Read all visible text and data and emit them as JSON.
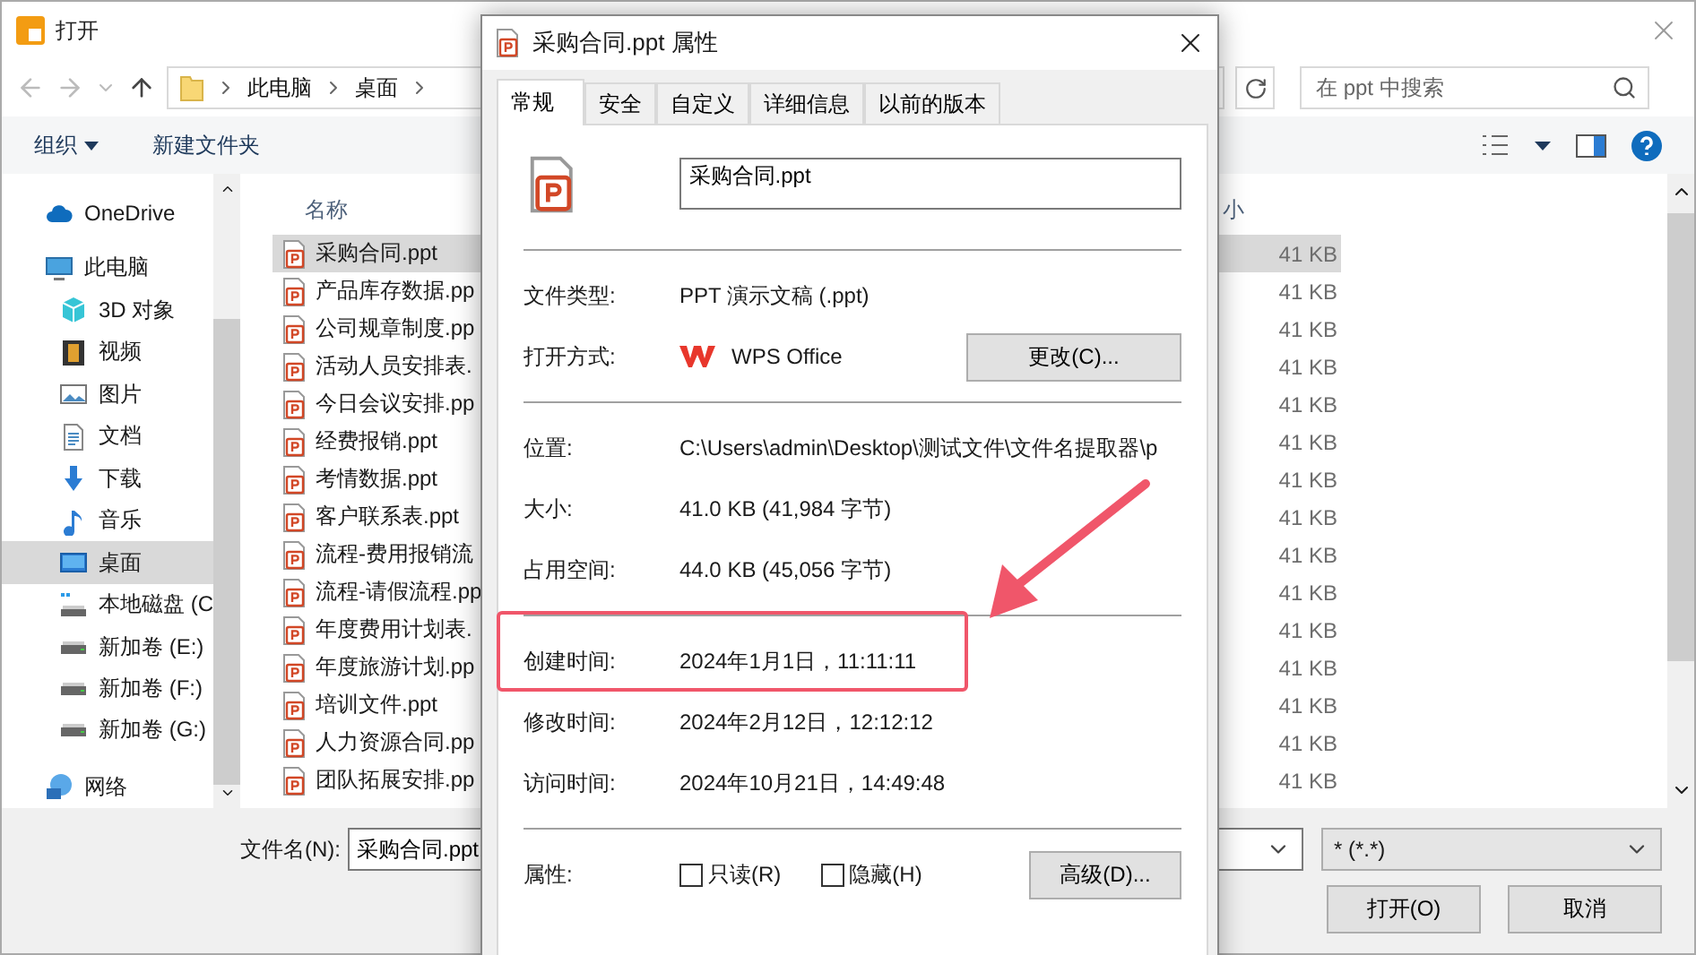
{
  "open_dialog": {
    "title": "打开",
    "breadcrumb": [
      "此电脑",
      "桌面"
    ],
    "search_placeholder": "在 ppt 中搜索",
    "toolbar": {
      "organize": "组织",
      "new_folder": "新建文件夹"
    },
    "sidebar": {
      "items": [
        {
          "kind": "cloud",
          "label": "OneDrive",
          "selected": false
        },
        {
          "kind": "pc",
          "label": "此电脑",
          "selected": false,
          "children": [
            {
              "kind": "cube",
              "label": "3D 对象",
              "selected": false
            },
            {
              "kind": "video",
              "label": "视频",
              "selected": false
            },
            {
              "kind": "image",
              "label": "图片",
              "selected": false
            },
            {
              "kind": "doc",
              "label": "文档",
              "selected": false
            },
            {
              "kind": "download",
              "label": "下载",
              "selected": false
            },
            {
              "kind": "music",
              "label": "音乐",
              "selected": false
            },
            {
              "kind": "desktop",
              "label": "桌面",
              "selected": true
            },
            {
              "kind": "system_drive",
              "label": "本地磁盘 (C",
              "selected": false
            },
            {
              "kind": "drive",
              "label": "新加卷 (E:)",
              "selected": false
            },
            {
              "kind": "drive",
              "label": "新加卷 (F:)",
              "selected": false
            },
            {
              "kind": "drive",
              "label": "新加卷 (G:)",
              "selected": false
            }
          ]
        },
        {
          "kind": "network",
          "label": "网络",
          "selected": false
        }
      ]
    },
    "columns": {
      "name": "名称",
      "size": "小"
    },
    "files": [
      {
        "name": "采购合同.ppt",
        "size": "41 KB",
        "selected": true
      },
      {
        "name": "产品库存数据.pp",
        "size": "41 KB",
        "selected": false
      },
      {
        "name": "公司规章制度.pp",
        "size": "41 KB",
        "selected": false
      },
      {
        "name": "活动人员安排表.",
        "size": "41 KB",
        "selected": false
      },
      {
        "name": "今日会议安排.pp",
        "size": "41 KB",
        "selected": false
      },
      {
        "name": "经费报销.ppt",
        "size": "41 KB",
        "selected": false
      },
      {
        "name": "考情数据.ppt",
        "size": "41 KB",
        "selected": false
      },
      {
        "name": "客户联系表.ppt",
        "size": "41 KB",
        "selected": false
      },
      {
        "name": "流程-费用报销流",
        "size": "41 KB",
        "selected": false
      },
      {
        "name": "流程-请假流程.pp",
        "size": "41 KB",
        "selected": false
      },
      {
        "name": "年度费用计划表.",
        "size": "41 KB",
        "selected": false
      },
      {
        "name": "年度旅游计划.pp",
        "size": "41 KB",
        "selected": false
      },
      {
        "name": "培训文件.ppt",
        "size": "41 KB",
        "selected": false
      },
      {
        "name": "人力资源合同.pp",
        "size": "41 KB",
        "selected": false
      },
      {
        "name": "团队拓展安排.pp",
        "size": "41 KB",
        "selected": false
      }
    ],
    "file_name_label": "文件名(N):",
    "file_name_value": "采购合同.ppt",
    "file_type_filter": "* (*.*)",
    "buttons": [
      "打开(O)",
      "取消"
    ]
  },
  "properties_dialog": {
    "title": "采购合同.ppt 属性",
    "tabs": [
      {
        "label": "常规",
        "selected": true
      },
      {
        "label": "安全",
        "selected": false
      },
      {
        "label": "自定义",
        "selected": false
      },
      {
        "label": "详细信息",
        "selected": false
      },
      {
        "label": "以前的版本",
        "selected": false
      }
    ],
    "file_name": "采购合同.ppt",
    "sections": [
      {
        "rows": [
          {
            "kind": "value",
            "label": "文件类型:",
            "value": "PPT 演示文稿 (.ppt)",
            "highlighted": false
          },
          {
            "kind": "open_with",
            "label": "打开方式:",
            "value": "WPS Office",
            "button": "更改(C)...",
            "highlighted": false
          }
        ]
      },
      {
        "rows": [
          {
            "kind": "value",
            "label": "位置:",
            "value": "C:\\Users\\admin\\Desktop\\测试文件\\文件名提取器\\p",
            "highlighted": false
          },
          {
            "kind": "value",
            "label": "大小:",
            "value": "41.0 KB (41,984 字节)",
            "highlighted": false
          },
          {
            "kind": "value",
            "label": "占用空间:",
            "value": "44.0 KB (45,056 字节)",
            "highlighted": false
          }
        ]
      },
      {
        "rows": [
          {
            "kind": "value",
            "label": "创建时间:",
            "value": "2024年1月1日，11:11:11",
            "highlighted": true
          },
          {
            "kind": "value",
            "label": "修改时间:",
            "value": "2024年2月12日，12:12:12",
            "highlighted": false
          },
          {
            "kind": "value",
            "label": "访问时间:",
            "value": "2024年10月21日，14:49:48",
            "highlighted": false
          }
        ]
      },
      {
        "rows": [
          {
            "kind": "attributes",
            "label": "属性:",
            "options": [
              {
                "label": "只读(R)",
                "checked": false
              },
              {
                "label": "隐藏(H)",
                "checked": false
              }
            ],
            "button": "高级(D)...",
            "highlighted": false
          }
        ]
      }
    ]
  }
}
